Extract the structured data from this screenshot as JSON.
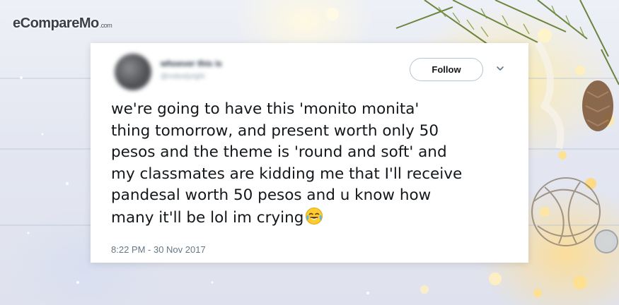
{
  "brand": {
    "logo_text": "eCompareMo",
    "logo_suffix": ".com"
  },
  "tweet": {
    "user_name": "whoever this is",
    "user_handle": "@nobodyright",
    "follow_label": "Follow",
    "menu_icon": "chevron-down-icon",
    "text": "we're going to have this 'monito monita'\nthing tomorrow, and present worth only 50\npesos and the theme is 'round and soft' and\nmy classmates are kidding me that I'll receive\npandesal worth 50 pesos and u know how\nmany it'll be lol im crying",
    "emoji": "face-with-tears-of-joy-icon",
    "timestamp": "8:22 PM - 30 Nov 2017"
  },
  "colors": {
    "follow_border": "#b8c4ce",
    "text": "#14171a",
    "timestamp": "#657786",
    "card_bg": "#ffffff"
  }
}
